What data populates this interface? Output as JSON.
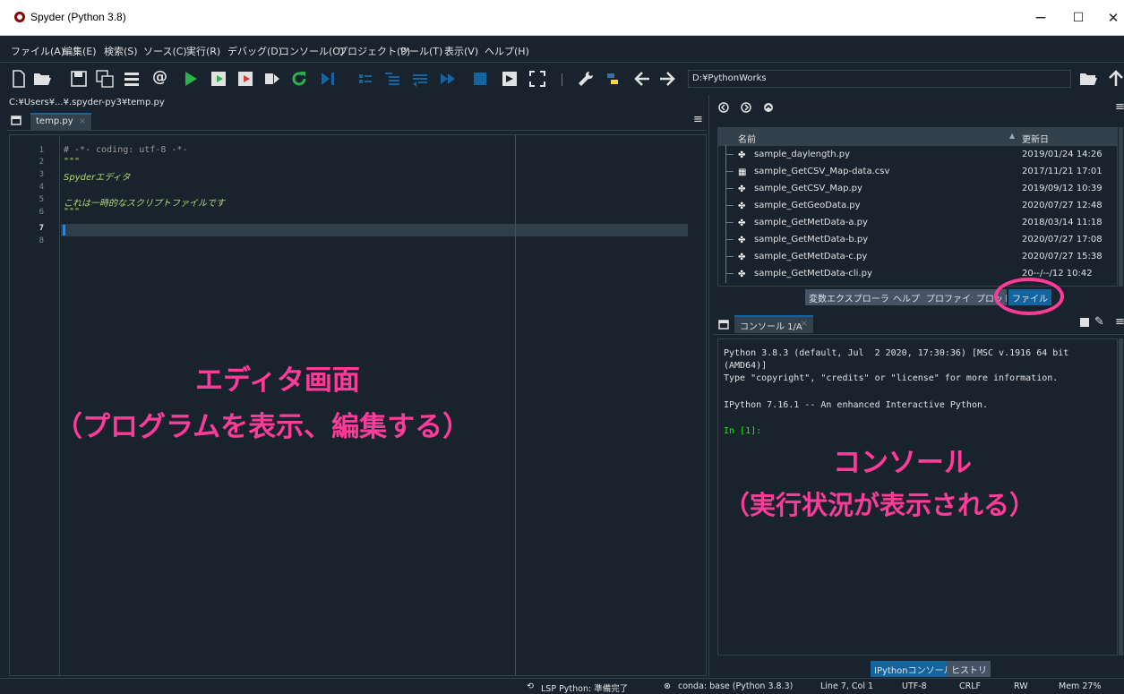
{
  "window": {
    "title": "Spyder (Python 3.8)",
    "minimize": "−",
    "maximize": "☐",
    "close": "✕"
  },
  "menubar": [
    "ファイル(A)",
    "編集(E)",
    "検索(S)",
    "ソース(C)",
    "実行(R)",
    "デバッグ(D)",
    "コンソール(O)",
    "プロジェクト(P)",
    "ツール(T)",
    "表示(V)",
    "ヘルプ(H)"
  ],
  "toolbar": {
    "at_symbol": "@",
    "working_dir": "D:¥PythonWorks"
  },
  "editor": {
    "file_path": "C:¥Users¥...¥.spyder-py3¥temp.py",
    "tab_label": "temp.py",
    "line_numbers": [
      "1",
      "2",
      "3",
      "4",
      "5",
      "6",
      "7",
      "8"
    ],
    "code_lines": [
      "# -*- coding: utf-8 -*-",
      "\"\"\"",
      "Spyderエディタ",
      "",
      "これは一時的なスクリプトファイルです",
      "\"\"\"",
      "",
      ""
    ],
    "annotation_line1": "エディタ画面",
    "annotation_line2": "（プログラムを表示、編集する）"
  },
  "file_explorer": {
    "header_name": "名前",
    "header_date": "更新日",
    "files": [
      {
        "name": "sample_daylength.py",
        "date": "2019/01/24 14:26",
        "icon": "python-file-icon"
      },
      {
        "name": "sample_GetCSV_Map-data.csv",
        "date": "2017/11/21 17:01",
        "icon": "csv-file-icon"
      },
      {
        "name": "sample_GetCSV_Map.py",
        "date": "2019/09/12 10:39",
        "icon": "python-file-icon"
      },
      {
        "name": "sample_GetGeoData.py",
        "date": "2020/07/27 12:48",
        "icon": "python-file-icon"
      },
      {
        "name": "sample_GetMetData-a.py",
        "date": "2018/03/14 11:18",
        "icon": "python-file-icon"
      },
      {
        "name": "sample_GetMetData-b.py",
        "date": "2020/07/27 17:08",
        "icon": "python-file-icon"
      },
      {
        "name": "sample_GetMetData-c.py",
        "date": "2020/07/27 15:38",
        "icon": "python-file-icon"
      },
      {
        "name": "sample_GetMetData-cli.py",
        "date": "20--/--/12 10:42",
        "icon": "python-file-icon"
      }
    ],
    "tabs": [
      "変数エクスプローラー",
      "ヘルプ",
      "プロファイラ",
      "プロット",
      "ファイル"
    ]
  },
  "console": {
    "tab_label": "コンソール 1/A",
    "lines": [
      "Python 3.8.3 (default, Jul  2 2020, 17:30:36) [MSC v.1916 64 bit",
      "(AMD64)]",
      "Type \"copyright\", \"credits\" or \"license\" for more information.",
      "",
      "IPython 7.16.1 -- An enhanced Interactive Python.",
      "",
      "In [1]:"
    ],
    "annotation_line1": "コンソール",
    "annotation_line2": "（実行状況が表示される）",
    "bottom_tabs": [
      "IPythonコンソール",
      "ヒストリ"
    ]
  },
  "statusbar": {
    "lsp": "LSP Python: 準備完了",
    "conda": "conda: base (Python 3.8.3)",
    "position": "Line 7, Col 1",
    "encoding": "UTF-8",
    "eol": "CRLF",
    "permissions": "RW",
    "memory": "Mem 27%"
  },
  "colors": {
    "background": "#19232d",
    "border": "#32414b",
    "annotation": "#ff3b9a",
    "accent": "#1464a0",
    "green_prompt": "#00ff00"
  }
}
